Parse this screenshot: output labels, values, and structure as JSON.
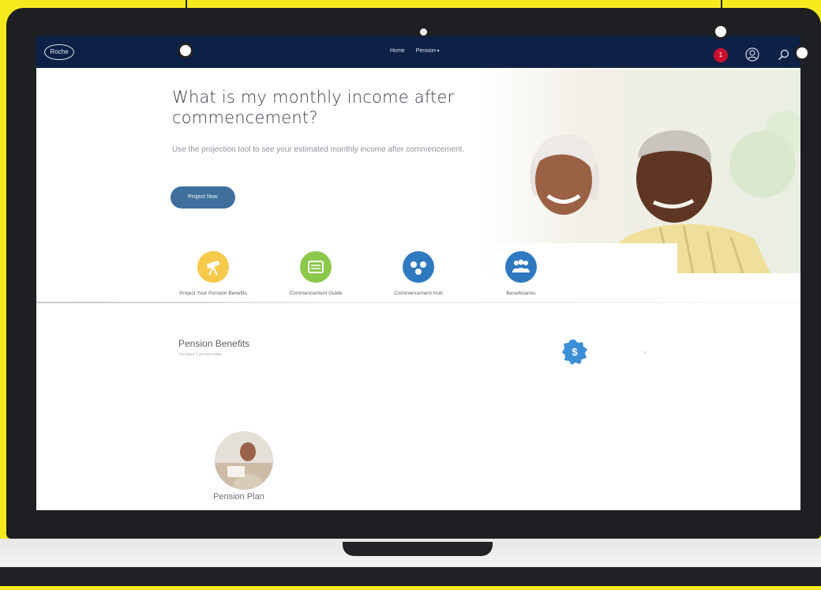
{
  "nav": {
    "logo": "Roche",
    "links": [
      "Home",
      "Pension"
    ],
    "notification_count": "1"
  },
  "hero": {
    "title": "What is my monthly income after commencement?",
    "subtitle": "Use the projection tool to see your estimated monthly income after commencement.",
    "button": "Project Now"
  },
  "quick_links": [
    {
      "label": "Project Your Pension Benefits",
      "icon": "telescope-icon",
      "color": "#f6c94a"
    },
    {
      "label": "Commencement Guide",
      "icon": "book-icon",
      "color": "#8cc84b"
    },
    {
      "label": "Commencement Hub",
      "icon": "hub-icon",
      "color": "#2f79c0"
    },
    {
      "label": "Beneficiaries",
      "icon": "people-icon",
      "color": "#2f79c0"
    }
  ],
  "pension": {
    "title": "Pension Benefits",
    "subtitle": "You have 1 pension plan",
    "plan_label": "Pension Plan"
  },
  "colors": {
    "navbar": "#0d2046",
    "accent": "#3f6f9c",
    "badge": "#c8102e",
    "background": "#f6ea1f"
  }
}
